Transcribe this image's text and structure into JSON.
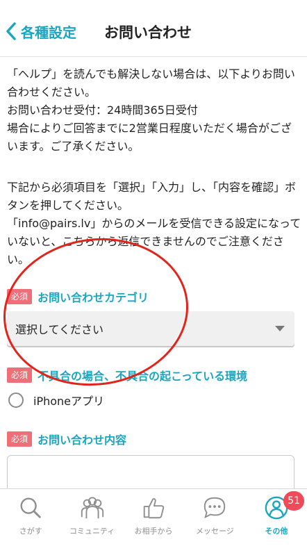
{
  "header": {
    "back_label": "各種設定",
    "title": "お問い合わせ"
  },
  "intro": {
    "text": "「ヘルプ」を読んでも解決しない場合は、以下よりお問い合わせください。\nお問い合わせ受付：24時間365日受付\n場合によりご回答までに2営業日程度いただく場合がございます。ご了承ください。"
  },
  "instructions": {
    "text": "下記から必須項目を「選択」「入力」し、「内容を確認」ボタンを押してください。\n「info@pairs.lv」からのメールを受信できる設定になっていないと、こちらから返信できませんのでご注意ください。"
  },
  "form": {
    "required_badge": "必須",
    "category": {
      "label": "お問い合わせカテゴリ",
      "selected": "選択してください"
    },
    "environment": {
      "label": "不具合の場合、不具合の起こっている環境",
      "option": "iPhoneアプリ"
    },
    "content": {
      "label": "お問い合わせ内容"
    }
  },
  "annotation": {
    "color": "#e0261c"
  },
  "colors": {
    "accent": "#1aa5c1",
    "badge": "#ef6f79",
    "notification": "#ef4a5a"
  },
  "tabbar": {
    "tabs": [
      {
        "label": "さがす",
        "icon": "search-icon"
      },
      {
        "label": "コミュニティ",
        "icon": "community-icon"
      },
      {
        "label": "お相手から",
        "icon": "thumbs-up-icon"
      },
      {
        "label": "メッセージ",
        "icon": "message-icon"
      },
      {
        "label": "その他",
        "icon": "profile-icon",
        "active": true
      }
    ],
    "notification_count": "51"
  }
}
